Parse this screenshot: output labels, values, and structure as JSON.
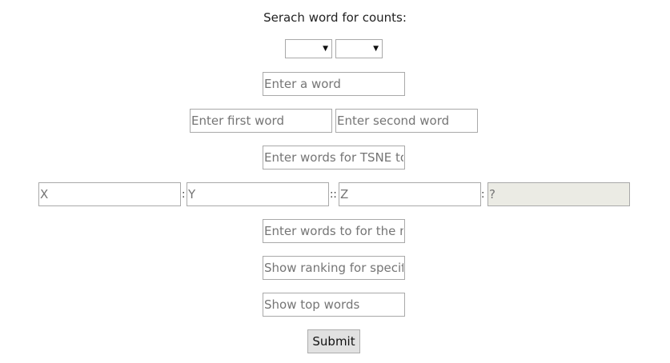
{
  "form": {
    "title": "Serach word for counts:",
    "selects": [
      {
        "value": "",
        "arrow_icon": "triangle-down"
      },
      {
        "value": "",
        "arrow_icon": "triangle-down"
      }
    ],
    "word_placeholder": "Enter a word",
    "first_word_placeholder": "Enter first word",
    "second_word_placeholder": "Enter second word",
    "tsne_placeholder": "Enter words for TSNE to visualize",
    "analogy": {
      "x_placeholder": "X",
      "y_placeholder": "Y",
      "z_placeholder": "Z",
      "result_placeholder": "?",
      "sep_1": ":",
      "sep_2": "::",
      "sep_3": ":"
    },
    "most_similar_placeholder": "Enter words to for the most similar",
    "ranking_placeholder": "Show ranking for specific word",
    "top_words_placeholder": "Show top words",
    "submit_label": "Submit"
  }
}
